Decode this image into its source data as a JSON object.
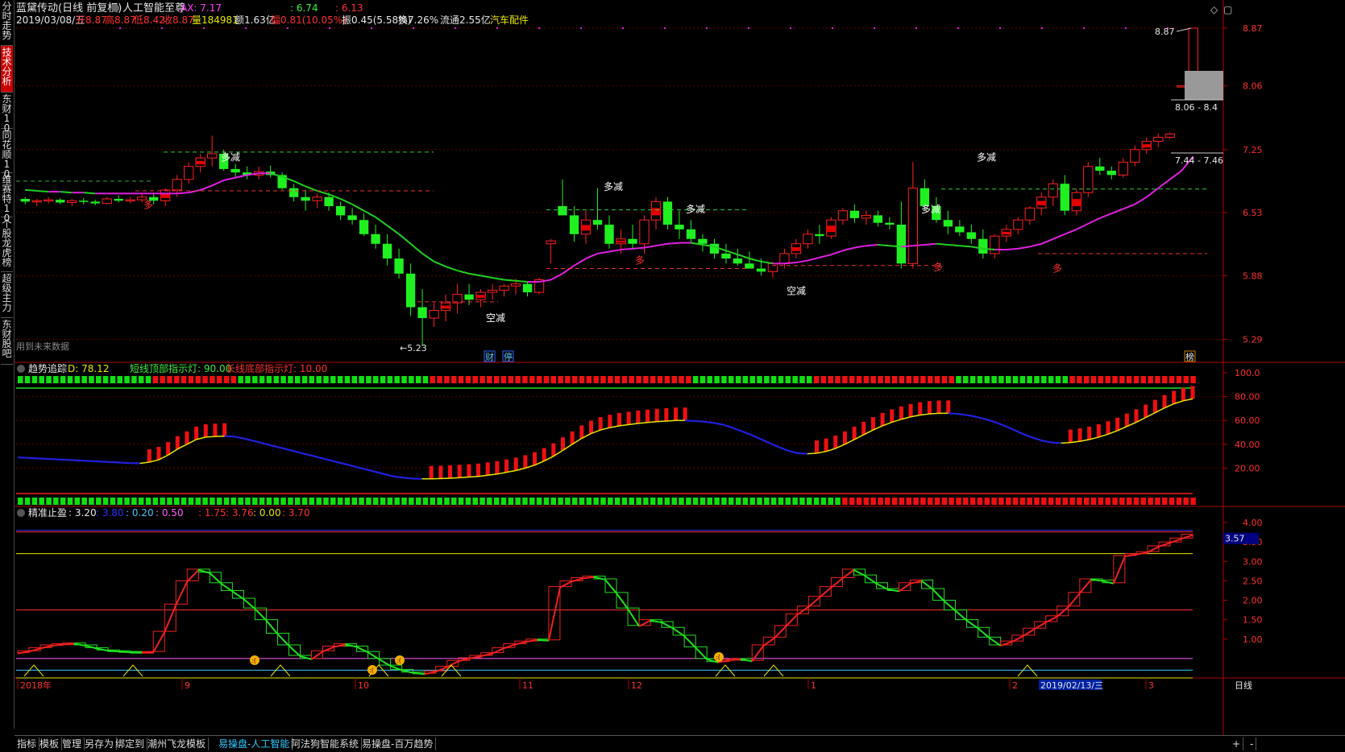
{
  "side_tabs": [
    {
      "label": "分时走势",
      "active": false
    },
    {
      "label": "技术分析",
      "active": true
    },
    {
      "label": "东财10",
      "active": false
    },
    {
      "label": "同花顺10",
      "active": false
    },
    {
      "label": "维赛特10",
      "active": false
    },
    {
      "label": "个股龙虎榜",
      "active": false
    },
    {
      "label": "超级主力",
      "active": false
    },
    {
      "label": "东财股吧",
      "active": false
    }
  ],
  "header": {
    "stock_name": "蓝黛传动(日线 前复权)",
    "indicator_name": "人工智能至尊",
    "ax_label": "AX: 7.17",
    "val1": ": 6.74",
    "val2": ": 6.13",
    "date": "2019/03/08/五",
    "open": "开8.87",
    "high": "高8.87",
    "low": "低8.42",
    "close": "收8.87",
    "volume": "量184981",
    "amount": "额1.63亿",
    "change": "幅0.81(10.05%)",
    "amplitude": "振0.45(5.58%)",
    "turnover": "换7.26%",
    "float": "流通2.55亿",
    "sector": "汽车配件"
  },
  "main_panel": {
    "price_ticks": [
      "8.87",
      "8.06",
      "7.25",
      "6.53",
      "5.88",
      "5.29"
    ],
    "last_price_label": "8.87",
    "min_label": "5.23",
    "box_label_1": "8.06 - 8.4",
    "box_label_2": "7.44 - 7.46",
    "future_note": "用到未来数据",
    "markers": [
      "财",
      "停",
      "榜"
    ],
    "signals": {
      "duo_jian": "多减",
      "kong_jian": "空减",
      "duo": "多"
    }
  },
  "trend_panel": {
    "title": "趋势追踪",
    "d_value": "D: 78.12",
    "short_label": "短线顶部指示灯: 90.00",
    "long_label": "长线底部指示灯: 10.00",
    "ticks": [
      "100.0",
      "80.00",
      "60.00",
      "40.00",
      "20.00"
    ]
  },
  "stop_panel": {
    "title": "精准止盈",
    "v1": ": 3.20",
    "v2": ": 3.80",
    "v3": ": 0.20",
    "v4": ": 0.50",
    "v5": ": 1.75",
    "v6": ": 3.76",
    "v7": ": 0.00",
    "v8": ": 3.70",
    "ticks": [
      "4.00",
      "3.50",
      "3.00",
      "2.50",
      "2.00",
      "1.50",
      "1.00"
    ],
    "current_label": "3.57"
  },
  "xaxis": {
    "labels": [
      "2018年",
      "9",
      "10",
      "11",
      "12",
      "1",
      "2",
      "3"
    ],
    "cursor_date": "2019/02/13/三",
    "period": "日线"
  },
  "bottom_bar": [
    "指标",
    "模板",
    "管理",
    "另存为",
    "绑定到",
    "潮州飞龙模板",
    "易操盘-人工智能",
    "阿法狗智能系统",
    "易操盘-百万趋势"
  ],
  "toolbar": {
    "plus": "+",
    "minus": "-"
  },
  "chart_data": [
    {
      "type": "candlestick",
      "title": "蓝黛传动(日线 前复权)",
      "ylim": [
        5.23,
        8.87
      ],
      "y_ticks": [
        8.87,
        8.06,
        7.25,
        6.53,
        5.88,
        5.29
      ],
      "candles": [
        [
          6.68,
          6.7,
          6.62,
          6.65
        ],
        [
          6.65,
          6.68,
          6.6,
          6.66
        ],
        [
          6.66,
          6.7,
          6.63,
          6.67
        ],
        [
          6.67,
          6.69,
          6.62,
          6.64
        ],
        [
          6.64,
          6.68,
          6.6,
          6.66
        ],
        [
          6.66,
          6.69,
          6.62,
          6.65
        ],
        [
          6.65,
          6.67,
          6.61,
          6.63
        ],
        [
          6.63,
          6.7,
          6.62,
          6.68
        ],
        [
          6.68,
          6.72,
          6.64,
          6.66
        ],
        [
          6.66,
          6.7,
          6.63,
          6.67
        ],
        [
          6.67,
          6.75,
          6.64,
          6.7
        ],
        [
          6.7,
          6.75,
          6.62,
          6.66
        ],
        [
          6.66,
          6.8,
          6.6,
          6.78
        ],
        [
          6.78,
          6.95,
          6.7,
          6.9
        ],
        [
          6.9,
          7.1,
          6.85,
          7.05
        ],
        [
          7.05,
          7.2,
          6.98,
          7.15
        ],
        [
          7.15,
          7.42,
          7.05,
          7.2
        ],
        [
          7.2,
          7.25,
          7.0,
          7.02
        ],
        [
          7.02,
          7.08,
          6.92,
          6.98
        ],
        [
          6.98,
          7.05,
          6.9,
          6.95
        ],
        [
          6.95,
          7.05,
          6.9,
          6.99
        ],
        [
          6.99,
          7.06,
          6.92,
          6.95
        ],
        [
          6.95,
          6.98,
          6.78,
          6.8
        ],
        [
          6.8,
          6.85,
          6.65,
          6.7
        ],
        [
          6.7,
          6.78,
          6.55,
          6.66
        ],
        [
          6.66,
          6.74,
          6.58,
          6.7
        ],
        [
          6.7,
          6.75,
          6.55,
          6.6
        ],
        [
          6.6,
          6.65,
          6.45,
          6.5
        ],
        [
          6.5,
          6.58,
          6.4,
          6.45
        ],
        [
          6.45,
          6.52,
          6.28,
          6.3
        ],
        [
          6.3,
          6.4,
          6.15,
          6.2
        ],
        [
          6.2,
          6.3,
          5.98,
          6.05
        ],
        [
          6.05,
          6.15,
          5.85,
          5.9
        ],
        [
          5.9,
          6.0,
          5.5,
          5.58
        ],
        [
          5.58,
          5.75,
          5.23,
          5.48
        ],
        [
          5.48,
          5.62,
          5.4,
          5.55
        ],
        [
          5.55,
          5.7,
          5.45,
          5.62
        ],
        [
          5.62,
          5.8,
          5.52,
          5.7
        ],
        [
          5.7,
          5.8,
          5.6,
          5.65
        ],
        [
          5.65,
          5.75,
          5.58,
          5.72
        ],
        [
          5.72,
          5.8,
          5.65,
          5.74
        ],
        [
          5.74,
          5.8,
          5.68,
          5.78
        ],
        [
          5.78,
          5.85,
          5.7,
          5.8
        ],
        [
          5.8,
          5.82,
          5.68,
          5.72
        ],
        [
          5.72,
          5.86,
          5.7,
          5.84
        ],
        [
          6.2,
          6.25,
          6.0,
          6.23
        ],
        [
          6.6,
          6.9,
          6.5,
          6.5
        ],
        [
          6.5,
          6.6,
          6.22,
          6.3
        ],
        [
          6.3,
          6.55,
          6.2,
          6.45
        ],
        [
          6.45,
          6.8,
          6.35,
          6.4
        ],
        [
          6.4,
          6.5,
          6.15,
          6.2
        ],
        [
          6.2,
          6.35,
          6.1,
          6.25
        ],
        [
          6.25,
          6.4,
          6.15,
          6.2
        ],
        [
          6.2,
          6.5,
          6.1,
          6.45
        ],
        [
          6.45,
          6.7,
          6.35,
          6.65
        ],
        [
          6.65,
          6.7,
          6.35,
          6.4
        ],
        [
          6.4,
          6.55,
          6.25,
          6.35
        ],
        [
          6.35,
          6.45,
          6.2,
          6.25
        ],
        [
          6.25,
          6.3,
          6.12,
          6.2
        ],
        [
          6.2,
          6.25,
          6.05,
          6.1
        ],
        [
          6.1,
          6.2,
          6.0,
          6.05
        ],
        [
          6.05,
          6.15,
          5.98,
          6.0
        ],
        [
          6.0,
          6.12,
          5.95,
          5.95
        ],
        [
          5.95,
          6.05,
          5.88,
          5.92
        ],
        [
          5.92,
          6.02,
          5.86,
          6.0
        ],
        [
          6.0,
          6.15,
          5.95,
          6.1
        ],
        [
          6.1,
          6.25,
          6.05,
          6.2
        ],
        [
          6.2,
          6.35,
          6.15,
          6.3
        ],
        [
          6.3,
          6.4,
          6.2,
          6.28
        ],
        [
          6.28,
          6.48,
          6.25,
          6.45
        ],
        [
          6.45,
          6.58,
          6.4,
          6.55
        ],
        [
          6.55,
          6.62,
          6.42,
          6.47
        ],
        [
          6.47,
          6.55,
          6.4,
          6.5
        ],
        [
          6.5,
          6.55,
          6.38,
          6.42
        ],
        [
          6.42,
          6.48,
          6.35,
          6.4
        ],
        [
          6.4,
          6.65,
          5.95,
          6.0
        ],
        [
          6.0,
          7.1,
          5.95,
          6.8
        ],
        [
          6.8,
          6.9,
          6.55,
          6.6
        ],
        [
          6.6,
          6.7,
          6.42,
          6.45
        ],
        [
          6.45,
          6.55,
          6.3,
          6.38
        ],
        [
          6.38,
          6.45,
          6.28,
          6.32
        ],
        [
          6.32,
          6.4,
          6.2,
          6.25
        ],
        [
          6.25,
          6.35,
          6.05,
          6.1
        ],
        [
          6.1,
          6.3,
          6.05,
          6.28
        ],
        [
          6.28,
          6.4,
          6.22,
          6.35
        ],
        [
          6.35,
          6.48,
          6.3,
          6.45
        ],
        [
          6.45,
          6.6,
          6.4,
          6.58
        ],
        [
          6.58,
          6.75,
          6.5,
          6.7
        ],
        [
          6.7,
          6.9,
          6.6,
          6.85
        ],
        [
          6.85,
          6.95,
          6.5,
          6.55
        ],
        [
          6.55,
          6.8,
          6.5,
          6.75
        ],
        [
          6.75,
          7.1,
          6.7,
          7.05
        ],
        [
          7.05,
          7.15,
          6.95,
          7.0
        ],
        [
          7.0,
          7.05,
          6.9,
          6.95
        ],
        [
          6.95,
          7.15,
          6.92,
          7.1
        ],
        [
          7.1,
          7.3,
          7.05,
          7.25
        ],
        [
          7.25,
          7.4,
          7.2,
          7.35
        ],
        [
          7.35,
          7.45,
          7.28,
          7.4
        ],
        [
          7.4,
          7.46,
          7.38,
          7.44
        ],
        [
          8.06,
          8.06,
          8.06,
          8.06
        ],
        [
          8.06,
          8.87,
          8.06,
          8.87
        ]
      ],
      "series": [
        {
          "name": "AX",
          "values": [
            6.78,
            6.77,
            6.76,
            6.76,
            6.75,
            6.75,
            6.74,
            6.74,
            6.74,
            6.74,
            6.74,
            6.74,
            6.74,
            6.74,
            6.75,
            6.78,
            6.83,
            6.89,
            6.92,
            6.95,
            6.97,
            6.97,
            6.93,
            6.88,
            6.82,
            6.77,
            6.73,
            6.68,
            6.62,
            6.55,
            6.48,
            6.39,
            6.3,
            6.2,
            6.1,
            6.02,
            5.97,
            5.93,
            5.9,
            5.88,
            5.86,
            5.84,
            5.83,
            5.82,
            5.82,
            5.84,
            5.9,
            5.98,
            6.05,
            6.1,
            6.12,
            6.14,
            6.15,
            6.16,
            6.18,
            6.2,
            6.21,
            6.21,
            6.19,
            6.17,
            6.13,
            6.09,
            6.05,
            6.02,
            6.0,
            6.0,
            6.01,
            6.03,
            6.06,
            6.09,
            6.13,
            6.16,
            6.18,
            6.19,
            6.18,
            6.17,
            6.18,
            6.19,
            6.2,
            6.19,
            6.18,
            6.17,
            6.15,
            6.14,
            6.14,
            6.15,
            6.17,
            6.2,
            6.25,
            6.3,
            6.35,
            6.41,
            6.47,
            6.52,
            6.57,
            6.62,
            6.7,
            6.8,
            6.9,
            7.0,
            7.17
          ]
        }
      ]
    },
    {
      "type": "line",
      "title": "趋势追踪",
      "ylim": [
        0,
        100
      ],
      "y_ticks": [
        100,
        80,
        60,
        40,
        20
      ],
      "series": [
        {
          "name": "D",
          "values": [
            29,
            28.6,
            28.2,
            27.8,
            27.4,
            27,
            26.6,
            26.2,
            25.8,
            25.4,
            25,
            24.6,
            24.2,
            24,
            25,
            27,
            31,
            36,
            40,
            44,
            46,
            46.5,
            46.8,
            46.5,
            45,
            43,
            41,
            39,
            37,
            35,
            33,
            31,
            29,
            27,
            25,
            23,
            21,
            19,
            17,
            15,
            13,
            12,
            11.2,
            11,
            11,
            11.2,
            11.5,
            12,
            12.5,
            13,
            14,
            15,
            16.5,
            18,
            20,
            22.5,
            26,
            30,
            35,
            40,
            45,
            49,
            52,
            54,
            55.5,
            56.5,
            57.5,
            58.3,
            59,
            59.5,
            60,
            60,
            59.5,
            59,
            58,
            56.5,
            54,
            51,
            48,
            44.5,
            41,
            37.5,
            34.5,
            32.5,
            32,
            32.5,
            34,
            36.5,
            40,
            44,
            48,
            52,
            55.5,
            58.5,
            61,
            63,
            64.5,
            65.5,
            66,
            66,
            65.5,
            64.5,
            63,
            61,
            58.5,
            55.5,
            52,
            48.5,
            45.5,
            43,
            41.5,
            41,
            41.5,
            42.5,
            44,
            46,
            48.5,
            51.5,
            55,
            58.5,
            62.5,
            66.5,
            70.5,
            74,
            76.5,
            78.12
          ]
        }
      ]
    },
    {
      "type": "line",
      "title": "精准止盈",
      "ylim": [
        0,
        4
      ],
      "y_ticks": [
        4,
        3.5,
        3,
        2.5,
        2,
        1.5,
        1
      ],
      "series": [
        {
          "name": "止盈",
          "values": [
            0.65,
            0.7,
            0.78,
            0.85,
            0.88,
            0.9,
            0.85,
            0.78,
            0.72,
            0.7,
            0.68,
            0.67,
            0.68,
            1.2,
            1.9,
            2.5,
            2.8,
            2.72,
            2.45,
            2.25,
            2.05,
            1.8,
            1.5,
            1.15,
            0.85,
            0.58,
            0.5,
            0.7,
            0.82,
            0.88,
            0.82,
            0.68,
            0.5,
            0.33,
            0.22,
            0.15,
            0.12,
            0.18,
            0.3,
            0.45,
            0.52,
            0.58,
            0.65,
            0.78,
            0.88,
            0.95,
            1.0,
            0.98,
            2.35,
            2.5,
            2.58,
            2.62,
            2.55,
            2.2,
            1.8,
            1.35,
            1.5,
            1.45,
            1.3,
            1.1,
            0.8,
            0.5,
            0.42,
            0.48,
            0.5,
            0.45,
            0.85,
            1.05,
            1.35,
            1.65,
            1.85,
            2.1,
            2.35,
            2.58,
            2.8,
            2.65,
            2.45,
            2.3,
            2.25,
            2.45,
            2.52,
            2.3,
            2.0,
            1.75,
            1.5,
            1.3,
            1.05,
            0.85,
            0.95,
            1.1,
            1.28,
            1.45,
            1.6,
            1.85,
            2.2,
            2.55,
            2.52,
            2.45,
            3.15,
            3.2,
            3.25,
            3.4,
            3.5,
            3.6,
            3.7
          ]
        }
      ]
    }
  ]
}
